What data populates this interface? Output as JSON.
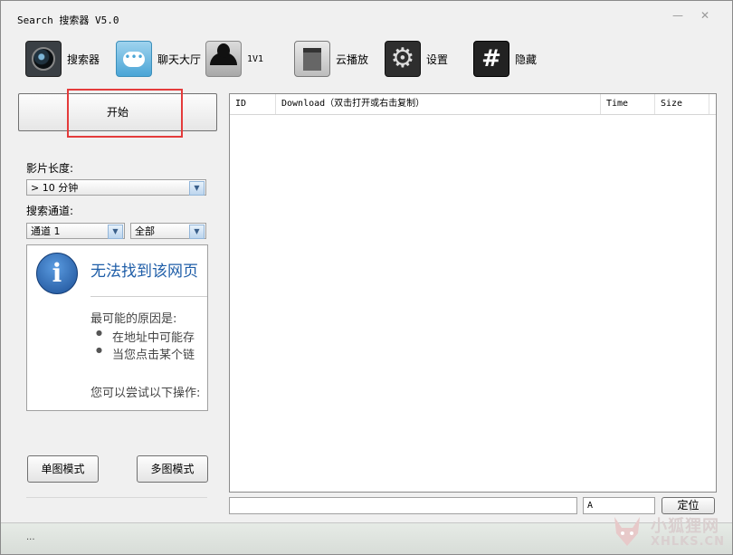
{
  "window": {
    "title": "Search 搜索器 V5.0",
    "minimize_glyph": "—",
    "close_glyph": "✕"
  },
  "toolbar": {
    "items": [
      {
        "label": "搜索器",
        "icon": "camera-icon"
      },
      {
        "label": "聊天大厅",
        "icon": "chat-bubble-icon",
        "icon_glyph": "•••"
      },
      {
        "label": "1V1",
        "icon": "user-silhouette-icon"
      },
      {
        "label": "云播放",
        "icon": "cloud-play-icon"
      },
      {
        "label": "设置",
        "icon": "gear-icon",
        "icon_glyph": "⚙"
      },
      {
        "label": "隐藏",
        "icon": "hash-icon",
        "icon_glyph": "#"
      }
    ]
  },
  "left_panel": {
    "start_label": "开始",
    "duration_label": "影片长度:",
    "duration_value": "> 10 分钟",
    "channel_label": "搜索通道:",
    "channel_value": "通道 1",
    "category_value": "全部",
    "single_mode_label": "单图模式",
    "multi_mode_label": "多图模式"
  },
  "browser_error": {
    "icon": "info-icon",
    "icon_glyph": "i",
    "title": "无法找到该网页",
    "reason_heading": "最可能的原因是:",
    "bullets": [
      "在地址中可能存",
      "当您点击某个链"
    ],
    "footer": "您可以尝试以下操作:"
  },
  "download_list": {
    "columns": [
      "ID",
      "Download（双击打开或右击复制）",
      "Time",
      "Size"
    ],
    "rows": []
  },
  "bottom_bar": {
    "search_value": "",
    "letter_value": "A",
    "locate_label": "定位"
  },
  "status": {
    "text": "..."
  },
  "watermark": {
    "title": "小狐狸网",
    "domain": "XHLKS.CN"
  }
}
